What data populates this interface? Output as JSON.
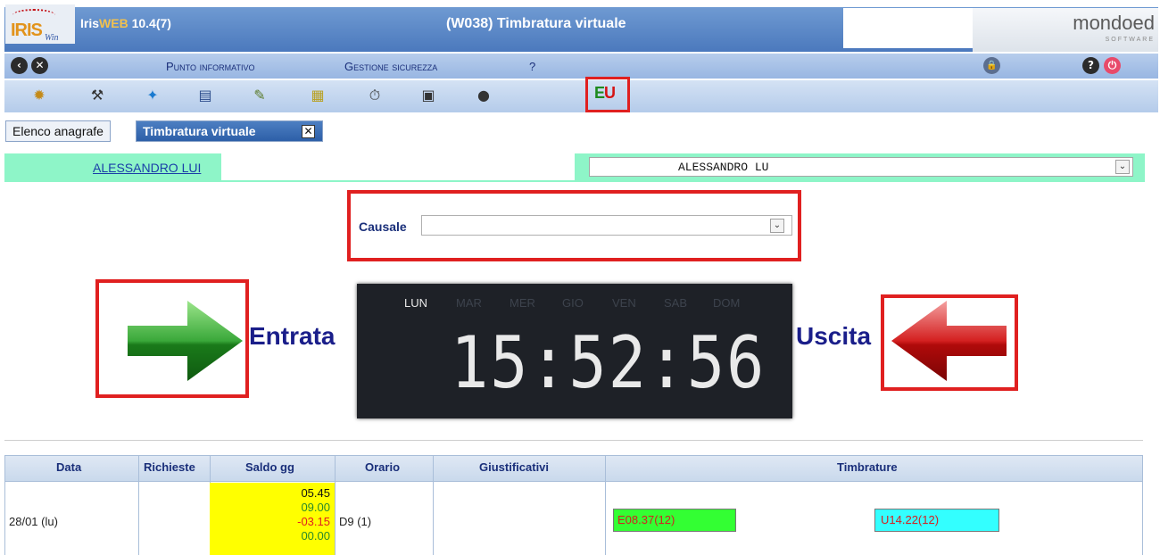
{
  "app": {
    "name_prefix": "Iris",
    "name_web": "WEB",
    "version": "10.4(7)",
    "window_title": "(W038) Timbratura virtuale",
    "logo_iris": "IRIS",
    "logo_iris_sub": "Win",
    "logo_mondo": "mondoed",
    "logo_mondo_sub": "SOFTWARE"
  },
  "menubar": {
    "items": [
      "Punto informativo",
      "Gestione sicurezza",
      "?"
    ]
  },
  "toolbar": {
    "icons": [
      "gear-cluster-icon",
      "users-tools-icon",
      "running-person-icon",
      "card-reader-icon",
      "document-check-icon",
      "calendar-hand-icon",
      "stopwatch-icon",
      "calculator-icon",
      "person-icon"
    ],
    "eu_label_e": "E",
    "eu_label_u": "U"
  },
  "tabs": {
    "elenco": "Elenco anagrafe",
    "timbratura": "Timbratura virtuale",
    "close_glyph": "✕"
  },
  "employee": {
    "name_link": "ALESSANDRO LUI",
    "select_value": "ALESSANDRO LU"
  },
  "causale": {
    "label": "Causale",
    "value": ""
  },
  "actions": {
    "entrata": "Entrata",
    "uscita": "Uscita"
  },
  "clock": {
    "days": [
      "LUN",
      "MAR",
      "MER",
      "GIO",
      "VEN",
      "SAB",
      "DOM"
    ],
    "active_day": "LUN",
    "time": "15:52:56"
  },
  "table": {
    "headers": [
      "Data",
      "Richieste",
      "Saldo gg",
      "Orario",
      "Giustificativi",
      "Timbrature"
    ],
    "row": {
      "data": "28/01 (lu)",
      "richieste": "",
      "saldo": [
        "05.45",
        "09.00",
        "-03.15",
        "00.00"
      ],
      "orario": "D9 (1)",
      "giustificativi": "",
      "timbrature": [
        "E08.37(12)",
        "U14.22(12)"
      ]
    }
  },
  "colors": {
    "accent_red": "#e02020",
    "title_blue": "#4b79bd",
    "employee_row": "#8ef5c8",
    "saldo_yellow": "#ffff00",
    "timbr_entrata": "#33ff33",
    "timbr_uscita": "#33ffff"
  }
}
